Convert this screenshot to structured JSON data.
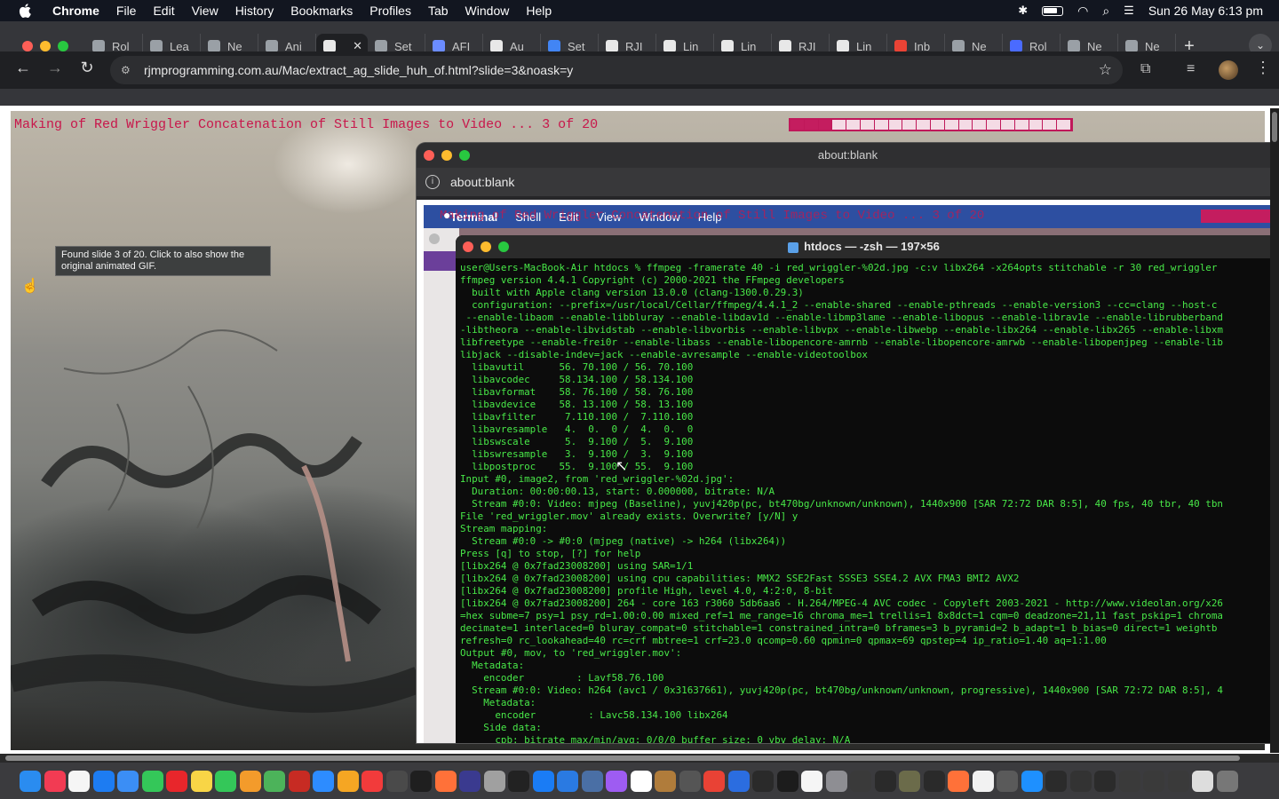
{
  "menubar": {
    "app_name": "Chrome",
    "items": [
      "File",
      "Edit",
      "View",
      "History",
      "Bookmarks",
      "Profiles",
      "Tab",
      "Window",
      "Help"
    ],
    "datetime": "Sun 26 May  6:13 pm"
  },
  "tabs": [
    {
      "title": "Rol",
      "fav_color": "#9aa0a6"
    },
    {
      "title": "Lea",
      "fav_color": "#9aa0a6"
    },
    {
      "title": "Ne",
      "fav_color": "#9aa0a6"
    },
    {
      "title": "Ani",
      "fav_color": "#9aa0a6"
    },
    {
      "title": "",
      "fav_color": "#e8e8e8",
      "active": true
    },
    {
      "title": "Set",
      "fav_color": "#9aa0a6"
    },
    {
      "title": "AFI",
      "fav_color": "#6b8cff"
    },
    {
      "title": "Au",
      "fav_color": "#e8e8e8"
    },
    {
      "title": "Set",
      "fav_color": "#4285f4"
    },
    {
      "title": "RJI",
      "fav_color": "#e8e8e8"
    },
    {
      "title": "Lin",
      "fav_color": "#e8e8e8"
    },
    {
      "title": "Lin",
      "fav_color": "#e8e8e8"
    },
    {
      "title": "RJI",
      "fav_color": "#e8e8e8"
    },
    {
      "title": "Lin",
      "fav_color": "#e8e8e8"
    },
    {
      "title": "Inb",
      "fav_color": "#ea4335"
    },
    {
      "title": "Ne",
      "fav_color": "#9aa0a6"
    },
    {
      "title": "Rol",
      "fav_color": "#4a6bff"
    },
    {
      "title": "Ne",
      "fav_color": "#9aa0a6"
    },
    {
      "title": "Ne",
      "fav_color": "#9aa0a6"
    }
  ],
  "address_bar": {
    "url": "rjmprogramming.com.au/Mac/extract_ag_slide_huh_of.html?slide=3&noask=y"
  },
  "page": {
    "slide_title": "Making of Red Wriggler Concatenation of Still Images to Video ... 3 of 20",
    "progress": {
      "current": 3,
      "total": 20
    },
    "tooltip": "Found slide 3 of 20.  Click to also show the original animated GIF."
  },
  "popup": {
    "title": "about:blank",
    "url": "about:blank"
  },
  "nested": {
    "menus": [
      "Terminal",
      "Shell",
      "Edit",
      "View",
      "Window",
      "Help"
    ],
    "ghost_title": "Making of Red Wriggler Concatenation of Still Images to Video ... 3 of 20"
  },
  "terminal": {
    "title": "htdocs — -zsh — 197×56",
    "lines": [
      "user@Users-MacBook-Air htdocs % ffmpeg -framerate 40 -i red_wriggler-%02d.jpg -c:v libx264 -x264opts stitchable -r 30 red_wriggler",
      "ffmpeg version 4.4.1 Copyright (c) 2000-2021 the FFmpeg developers",
      "  built with Apple clang version 13.0.0 (clang-1300.0.29.3)",
      "  configuration: --prefix=/usr/local/Cellar/ffmpeg/4.4.1_2 --enable-shared --enable-pthreads --enable-version3 --cc=clang --host-c",
      " --enable-libaom --enable-libbluray --enable-libdav1d --enable-libmp3lame --enable-libopus --enable-librav1e --enable-librubberband",
      "-libtheora --enable-libvidstab --enable-libvorbis --enable-libvpx --enable-libwebp --enable-libx264 --enable-libx265 --enable-libxm",
      "libfreetype --enable-frei0r --enable-libass --enable-libopencore-amrnb --enable-libopencore-amrwb --enable-libopenjpeg --enable-lib",
      "libjack --disable-indev=jack --enable-avresample --enable-videotoolbox",
      "  libavutil      56. 70.100 / 56. 70.100",
      "  libavcodec     58.134.100 / 58.134.100",
      "  libavformat    58. 76.100 / 58. 76.100",
      "  libavdevice    58. 13.100 / 58. 13.100",
      "  libavfilter     7.110.100 /  7.110.100",
      "  libavresample   4.  0.  0 /  4.  0.  0",
      "  libswscale      5.  9.100 /  5.  9.100",
      "  libswresample   3.  9.100 /  3.  9.100",
      "  libpostproc    55.  9.100 / 55.  9.100",
      "Input #0, image2, from 'red_wriggler-%02d.jpg':",
      "  Duration: 00:00:00.13, start: 0.000000, bitrate: N/A",
      "  Stream #0:0: Video: mjpeg (Baseline), yuvj420p(pc, bt470bg/unknown/unknown), 1440x900 [SAR 72:72 DAR 8:5], 40 fps, 40 tbr, 40 tbn",
      "File 'red_wriggler.mov' already exists. Overwrite? [y/N] y",
      "Stream mapping:",
      "  Stream #0:0 -> #0:0 (mjpeg (native) -> h264 (libx264))",
      "Press [q] to stop, [?] for help",
      "[libx264 @ 0x7fad23008200] using SAR=1/1",
      "[libx264 @ 0x7fad23008200] using cpu capabilities: MMX2 SSE2Fast SSSE3 SSE4.2 AVX FMA3 BMI2 AVX2",
      "[libx264 @ 0x7fad23008200] profile High, level 4.0, 4:2:0, 8-bit",
      "[libx264 @ 0x7fad23008200] 264 - core 163 r3060 5db6aa6 - H.264/MPEG-4 AVC codec - Copyleft 2003-2021 - http://www.videolan.org/x26",
      "=hex subme=7 psy=1 psy_rd=1.00:0.00 mixed_ref=1 me_range=16 chroma_me=1 trellis=1 8x8dct=1 cqm=0 deadzone=21,11 fast_pskip=1 chroma",
      "decimate=1 interlaced=0 bluray_compat=0 stitchable=1 constrained_intra=0 bframes=3 b_pyramid=2 b_adapt=1 b_bias=0 direct=1 weightb",
      "refresh=0 rc_lookahead=40 rc=crf mbtree=1 crf=23.0 qcomp=0.60 qpmin=0 qpmax=69 qpstep=4 ip_ratio=1.40 aq=1:1.00",
      "Output #0, mov, to 'red_wriggler.mov':",
      "  Metadata:",
      "    encoder         : Lavf58.76.100",
      "  Stream #0:0: Video: h264 (avc1 / 0x31637661), yuvj420p(pc, bt470bg/unknown/unknown, progressive), 1440x900 [SAR 72:72 DAR 8:5], 4",
      "    Metadata:",
      "      encoder         : Lavc58.134.100 libx264",
      "    Side data:",
      "      cpb: bitrate max/min/avg: 0/0/0 buffer size: 0 vbv_delay: N/A"
    ]
  },
  "dock": {
    "icons": [
      "finder-icon",
      "music-icon",
      "reminders-icon",
      "safari-icon",
      "mail-icon",
      "messages-icon",
      "opera-icon",
      "notes-icon",
      "facetime-icon",
      "pages-icon",
      "maps-icon",
      "filezilla-icon",
      "zoom-icon",
      "photos-icon",
      "news-icon",
      "xcode-icon",
      "terminal-icon",
      "firefox-icon",
      "bbedit-icon",
      "launchpad-icon",
      "appletv-icon",
      "appstore-icon",
      "xcode-icon",
      "preview-icon",
      "podcasts-icon",
      "calendar-icon",
      "books-icon",
      "calculator-icon",
      "chrome-icon",
      "code-icon",
      "terminal2-icon",
      "quicktime-icon",
      "textedit-icon",
      "settings-icon",
      "app-icon",
      "console-icon",
      "gimp-icon",
      "inkscape-icon",
      "firefox2-icon",
      "script-icon",
      "system-preferences-icon",
      "folder-icon",
      "window1-icon",
      "window2-icon",
      "window3-icon",
      "minimized1-icon",
      "minimized2-icon",
      "minimized3-icon",
      "minimized4-icon",
      "trash-icon"
    ],
    "colors": [
      "#2a8cf0",
      "#f23b53",
      "#f5f5f5",
      "#1d7cf2",
      "#3b8ef5",
      "#34c759",
      "#e8262b",
      "#f8d546",
      "#34c759",
      "#f39b2b",
      "#4cb35a",
      "#c72b23",
      "#2d8cff",
      "#f5a623",
      "#f23b3b",
      "#4a4a4a",
      "#1f1f1f",
      "#ff7139",
      "#3a3a8f",
      "#a0a0a0",
      "#222222",
      "#1a7cf5",
      "#2a7ae2",
      "#4a6fa5",
      "#9e5cf2",
      "#ffffff",
      "#b07c3b",
      "#555555",
      "#e94235",
      "#2b6de0",
      "#2a2a2a",
      "#1c1c1c",
      "#f5f5f5",
      "#8e8e93",
      "#3a3a3a",
      "#2a2a2a",
      "#6b6b4a",
      "#2a2a2a",
      "#ff7139",
      "#f2f2f2",
      "#5a5a5a",
      "#1e90ff",
      "#2b2b2b",
      "#333333",
      "#2b2b2b",
      "#3a3a3a",
      "#3a3a3a",
      "#3a3a3a",
      "#ddd",
      "#777777"
    ]
  }
}
